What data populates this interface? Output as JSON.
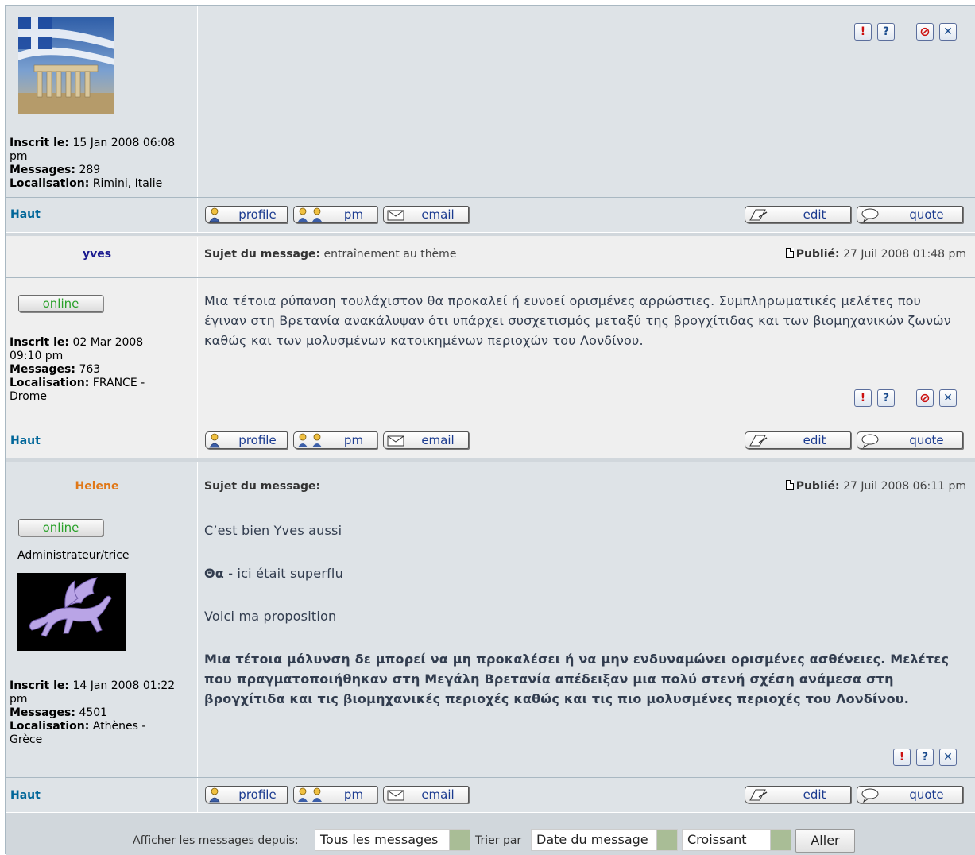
{
  "posts": [
    {
      "author": "",
      "joined_label": "Inscrit le:",
      "joined_value": "15 Jan 2008 06:08 pm",
      "posts_label": "Messages:",
      "posts_value": "289",
      "location_label": "Localisation:",
      "location_value": "Rimini, Italie"
    },
    {
      "author": "yves",
      "author_color": "#1a1a8f",
      "online_label": "online",
      "joined_label": "Inscrit le:",
      "joined_value": "02 Mar 2008 09:10 pm",
      "posts_label": "Messages:",
      "posts_value": "763",
      "location_label": "Localisation:",
      "location_value": "FRANCE - Drome",
      "subject_label": "Sujet du message:",
      "subject_value": "entraînement au thème",
      "posted_label": "Publié:",
      "posted_value": "27 Juil 2008 01:48 pm",
      "body": "Μια τέτοια ρύπανση τουλάχιστον θα προκαλεί ή ευνοεί ορισμένες αρρώστιες. Συμπληρωματικές μελέτες που έγιναν στη Βρετανία ανακάλυψαν ότι υπάρχει συσχετισμός μεταξύ της βρογχίτιδας και των βιομηχανικών ζωνών καθώς και των μολυσμένων κατοικημένων περιοχών του Λονδίνου."
    },
    {
      "author": "Helene",
      "author_color": "#e07818",
      "online_label": "online",
      "rank": "Administrateur/trice",
      "joined_label": "Inscrit le:",
      "joined_value": "14 Jan 2008 01:22 pm",
      "posts_label": "Messages:",
      "posts_value": "4501",
      "location_label": "Localisation:",
      "location_value": "Athènes - Grèce",
      "subject_label": "Sujet du message:",
      "subject_value": "",
      "posted_label": "Publié:",
      "posted_value": "27 Juil 2008 06:11 pm",
      "body_p1": "C’est bien Yves aussi",
      "body_p2_bold": "Θα",
      "body_p2_rest": " - ici était superflu",
      "body_p3": "Voici ma proposition",
      "body_p4": "Μια τέτοια μόλυνση δε μπορεί να μη προκαλέσει ή να μην ενδυναμώνει ορισμένες ασθένειες. Μελέτες που πραγματοποιήθηκαν στη Μεγάλη Βρετανία απέδειξαν μια πολύ στενή σχέση ανάμεσα στη βρογχίτιδα και τις βιομηχανικές περιοχές καθώς και τις πιο μολυσμένες περιοχές του Λονδίνου."
    }
  ],
  "actions": {
    "haut": "Haut",
    "profile": "profile",
    "pm": "pm",
    "email": "email",
    "edit": "edit",
    "quote": "quote",
    "report_icon": "!",
    "info_icon": "?",
    "ban_icon": "⃠",
    "delete_icon": "✕"
  },
  "footer": {
    "show_label": "Afficher les messages depuis:",
    "show_value": "Tous les messages",
    "sort_label": "Trier par",
    "sort_value": "Date du message",
    "order_value": "Croissant",
    "go_label": "Aller"
  }
}
